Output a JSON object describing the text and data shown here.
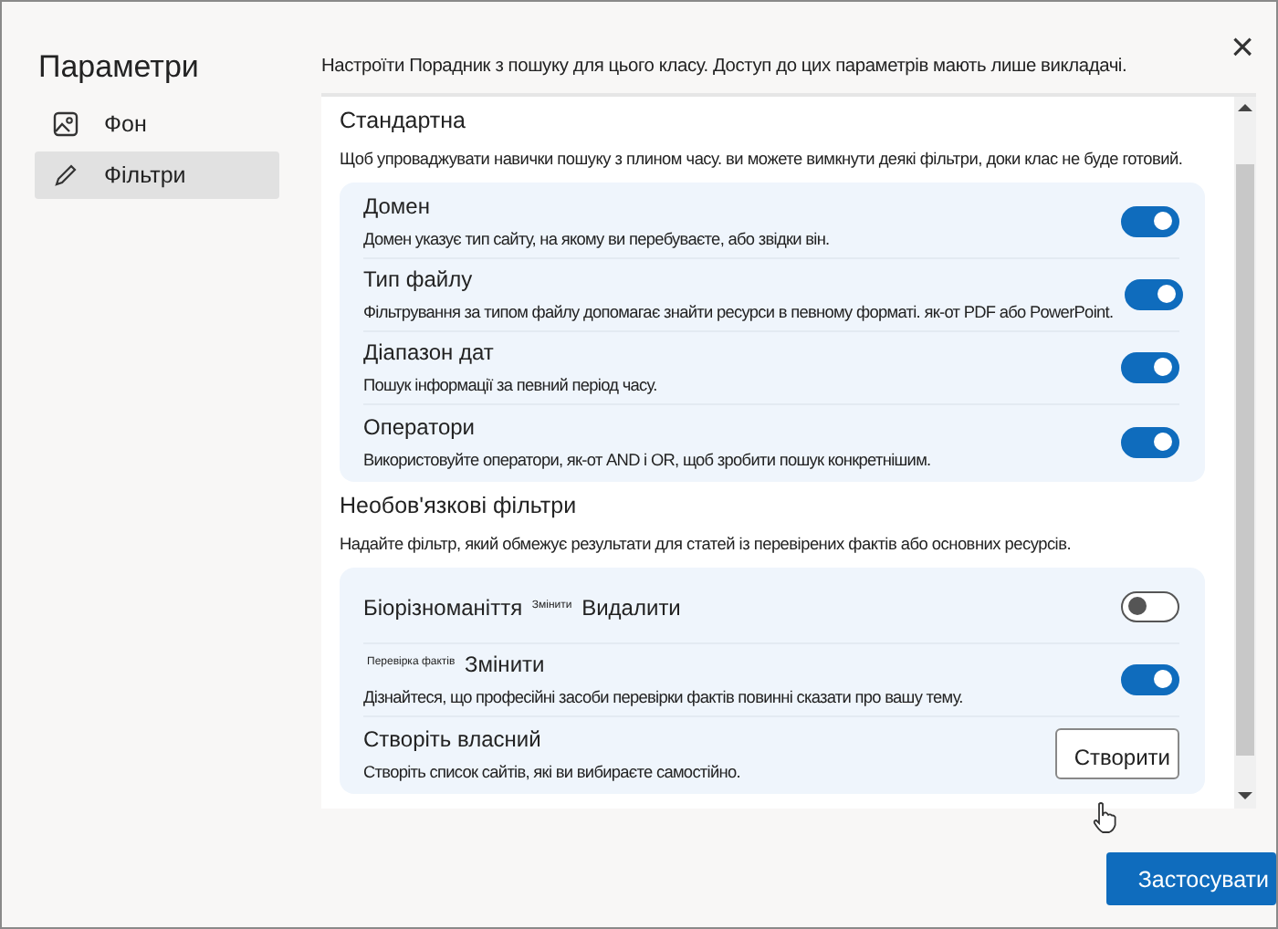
{
  "sidebar": {
    "title": "Параметри",
    "items": [
      {
        "label": "Фон",
        "kind": "image",
        "selected": false
      },
      {
        "label": "Фільтри",
        "kind": "pencil",
        "selected": true
      }
    ]
  },
  "header": {
    "text": "Настроїти Порадник з пошуку для цього класу. Доступ до цих параметрів мають лише викладачі.",
    "close": "×"
  },
  "sections": [
    {
      "title": "Стандартна",
      "description": "Щоб упроваджувати навички пошуку з плином часу. ви можете вимкнути деякі фільтри, доки клас не буде готовий.",
      "rows": [
        {
          "kind": "toggle",
          "title": "Домен",
          "description": "Домен указує тип сайту, на якому ви перебуваєте, або звідки він.",
          "on": true
        },
        {
          "kind": "toggle",
          "title": "Тип файлу",
          "description": "Фільтрування за типом файлу допомагає знайти ресурси в певному форматі. як-от PDF або PowerPoint.",
          "on": true
        },
        {
          "kind": "toggle",
          "title": "Діапазон дат",
          "description": "Пошук інформації за певний період часу.",
          "on": true
        },
        {
          "kind": "toggle",
          "title": "Оператори",
          "description": "Використовуйте оператори, як-от AND і OR, щоб зробити пошук конкретнішим.",
          "on": true
        }
      ]
    },
    {
      "title": "Необов'язкові фільтри",
      "description": "Надайте фільтр, який обмежує результати для статей із перевірених фактів або основних ресурсів.",
      "rows": [
        {
          "kind": "toggle",
          "title": "Біорізноманіття $^{Змінити}$ Видалити",
          "on": false
        },
        {
          "kind": "toggle",
          "title": "$^{Перевірка фактів}$ Змінити",
          "description": "Дізнайтеся, що професійні засоби перевірки фактів повинні сказати про вашу тему.",
          "on": true
        },
        {
          "kind": "button",
          "title": "Створіть власний",
          "description": "Створіть список сайтів, які ви вибираєте самостійно.",
          "button": "Створити"
        }
      ]
    }
  ],
  "apply_button": "Застосувати"
}
